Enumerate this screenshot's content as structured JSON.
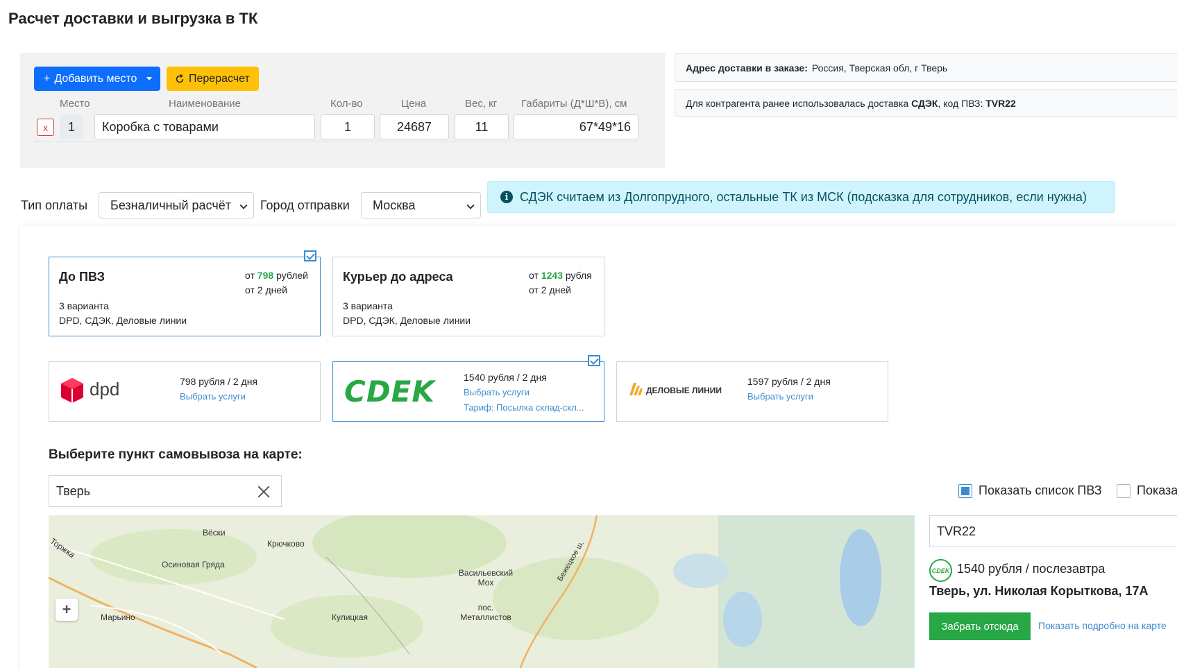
{
  "page": {
    "title": "Расчет доставки и выгрузка в ТК"
  },
  "places": {
    "add_button": "Добавить место",
    "recalc_button": "Перерасчет",
    "headers": {
      "place": "Место",
      "name": "Наименование",
      "qty": "Кол-во",
      "price": "Цена",
      "weight": "Вес, кг",
      "dims": "Габариты (Д*Ш*В), см"
    },
    "row": {
      "delete": "x",
      "num": "1",
      "name": "Коробка с товарами",
      "qty": "1",
      "price": "24687",
      "weight": "11",
      "dims": "67*49*16"
    }
  },
  "info": {
    "address_label": "Адрес доставки в заказе:",
    "address_value": "Россия, Тверская обл, г Тверь",
    "prev_text": "Для контрагента ранее использовалась доставка",
    "prev_carrier": "СДЭК",
    "prev_code_label": ", код ПВЗ:",
    "prev_code": "TVR22"
  },
  "payment": {
    "type_label": "Тип оплаты",
    "type_value": "Безналичный расчёт",
    "city_label": "Город отправки",
    "city_value": "Москва",
    "hint_icon": "i",
    "hint": "СДЭК считаем из Долгопрудного, остальные ТК из МСК (подсказка для сотрудников, если нужна)"
  },
  "options": [
    {
      "title": "До ПВЗ",
      "price_prefix": "от",
      "price": "798",
      "price_suffix": "рублей",
      "days": "от 2 дней",
      "count": "3 варианта",
      "carriers": "DPD, СДЭК, Деловые линии",
      "selected": true
    },
    {
      "title": "Курьер до адреса",
      "price_prefix": "от",
      "price": "1243",
      "price_suffix": "рубля",
      "days": "от 2 дней",
      "count": "3 варианта",
      "carriers": "DPD, СДЭК, Деловые линии",
      "selected": false
    }
  ],
  "carriers": [
    {
      "logo": "dpd",
      "price": "798 рубля / 2 дня",
      "link": "Выбрать услуги",
      "selected": false
    },
    {
      "logo": "CDEK",
      "price": "1540 рубля / 2 дня",
      "link": "Выбрать услуги",
      "tariff": "Тариф: Посылка склад-скл...",
      "selected": true
    },
    {
      "logo": "ДЕЛОВЫЕ ЛИНИИ",
      "price": "1597 рубля / 2 дня",
      "link": "Выбрать услуги",
      "selected": false
    }
  ],
  "pickup": {
    "title": "Выберите пункт самовывоза на карте:",
    "search_value": "Тверь",
    "show_list_label": "Показать список ПВЗ",
    "show_list_checked": true,
    "show_other_label": "Показа",
    "show_other_checked": false,
    "pvz_code": "TVR22",
    "logo": "CDEK",
    "price": "1540 рубля / послезавтра",
    "address": "Тверь, ул. Николая Корыткова, 17А",
    "take_button": "Забрать отсюда",
    "show_on_map": "Показать подробно на карте"
  },
  "map": {
    "labels": [
      "Вёски",
      "Крючково",
      "Торжка",
      "Осиновая Гряда",
      "Марьино",
      "Кулицкая",
      "Васильевский Мох",
      "пос. Металлистов",
      "Бежецкое ш."
    ]
  },
  "colors": {
    "primary": "#0d6efd",
    "warning": "#ffc107",
    "success": "#28a745",
    "link": "#3d8bd0",
    "hint_bg": "#cff4fc"
  }
}
